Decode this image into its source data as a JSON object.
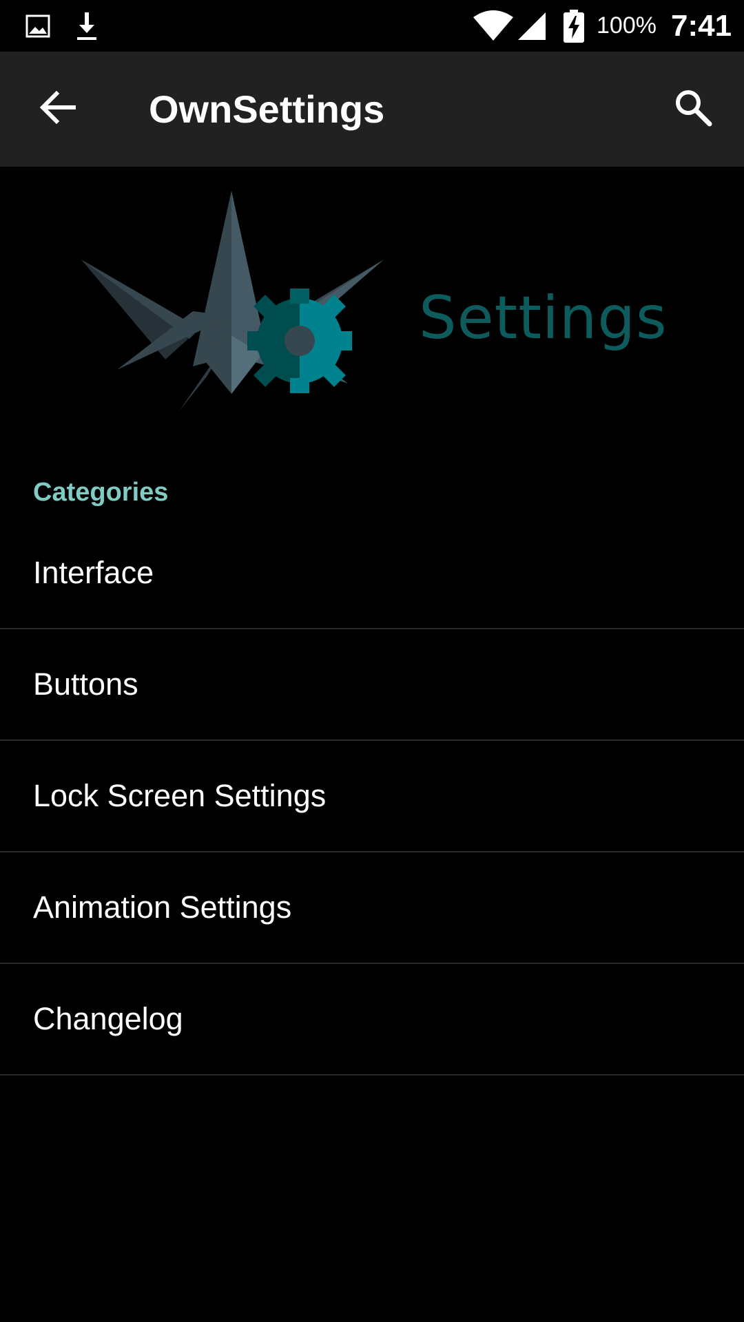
{
  "status_bar": {
    "battery": "100%",
    "time": "7:41",
    "icons": [
      "image-notification-icon",
      "download-icon",
      "wifi-icon",
      "signal-icon",
      "battery-charging-icon"
    ]
  },
  "app_bar": {
    "title": "OwnSettings",
    "back_icon": "arrow-back-icon",
    "search_icon": "search-icon"
  },
  "banner": {
    "text": "Settings",
    "text_color": "#0e5b5d",
    "logo_colors": [
      "#37474f",
      "#00838f",
      "#004d4f"
    ]
  },
  "categories": {
    "header": "Categories",
    "header_color": "#80cbc4",
    "items": [
      {
        "label": "Interface"
      },
      {
        "label": "Buttons"
      },
      {
        "label": "Lock Screen Settings"
      },
      {
        "label": "Animation Settings"
      },
      {
        "label": "Changelog"
      }
    ]
  }
}
